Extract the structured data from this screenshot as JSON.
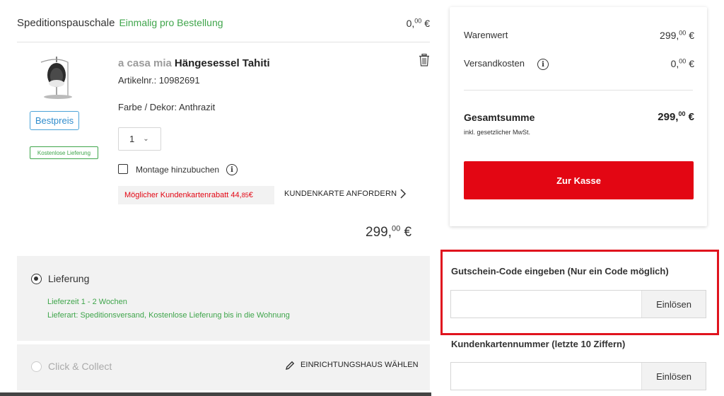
{
  "shipping": {
    "title": "Speditionspauschale",
    "note": "Einmalig pro Bestellung",
    "price_main": "0,",
    "price_cents": "00",
    "price_currency": " €"
  },
  "product": {
    "brand": "a casa mia",
    "name": "Hängesessel Tahiti",
    "article_number": "Artikelnr.: 10982691",
    "color": "Farbe / Dekor: Anthrazit",
    "badge_bestpreis": "Bestpreis",
    "badge_free_delivery": "Kostenlose Lieferung",
    "quantity": "1",
    "montage_label": "Montage hinzubuchen",
    "montage_checked": false,
    "rabatt_text": "Möglicher Kundenkartenrabatt 44,",
    "rabatt_cents": "85",
    "rabatt_currency": " €",
    "kundenkarte_link": "KUNDENKARTE ANFORDERN",
    "price_main": "299,",
    "price_cents": "00",
    "price_currency": " €"
  },
  "delivery_options": {
    "delivery": {
      "label": "Lieferung",
      "selected": true,
      "time": "Lieferzeit 1 - 2 Wochen",
      "type": "Lieferart: Speditionsversand, Kostenlose Lieferung bis in die Wohnung"
    },
    "collect": {
      "label": "Click & Collect",
      "selected": false,
      "action": "EINRICHTUNGSHAUS WÄHLEN"
    }
  },
  "summary": {
    "warenwert_label": "Warenwert",
    "warenwert_main": "299,",
    "warenwert_cents": "00",
    "warenwert_currency": " €",
    "versand_label": "Versandkosten",
    "versand_main": "0,",
    "versand_cents": "00",
    "versand_currency": " €",
    "total_label": "Gesamtsumme",
    "total_main": "299,",
    "total_cents": "00",
    "total_currency": " €",
    "tax_note": "inkl. gesetzlicher MwSt.",
    "checkout_label": "Zur Kasse"
  },
  "voucher": {
    "label": "Gutschein-Code eingeben (Nur ein Code möglich)",
    "value": "",
    "button": "Einlösen"
  },
  "customer_card": {
    "label": "Kundenkartennummer (letzte 10 Ziffern)",
    "value": "",
    "button": "Einlösen"
  },
  "colors": {
    "accent_red": "#e30613",
    "green": "#3fa54b",
    "blue": "#2f8ccc",
    "panel_gray": "#f2f2f2"
  }
}
